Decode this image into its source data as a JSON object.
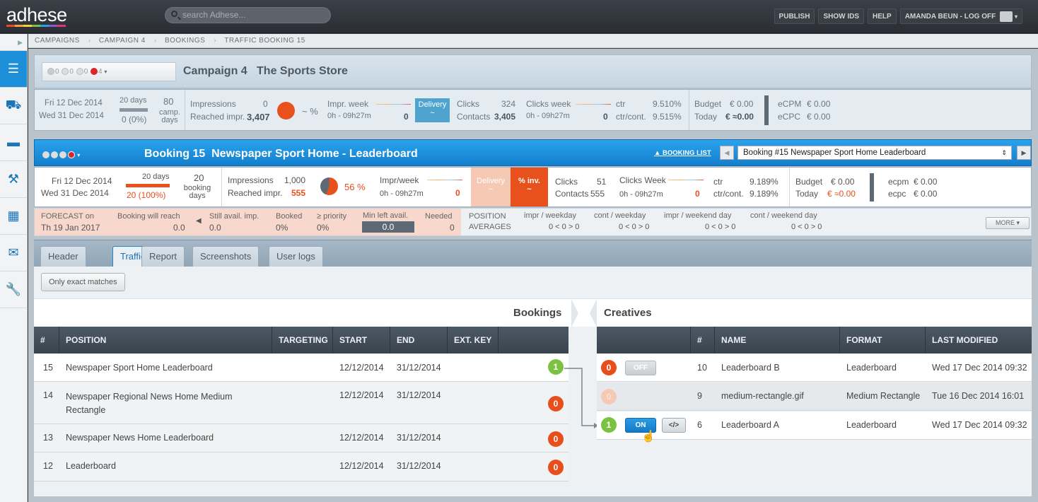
{
  "app": {
    "logo": "adhese",
    "search_placeholder": "search Adhese..."
  },
  "topnav": {
    "publish": "PUBLISH",
    "show_ids": "SHOW IDS",
    "help": "HELP",
    "user": "AMANDA BEUN - LOG OFF"
  },
  "breadcrumb": [
    "CAMPAIGNS",
    "CAMPAIGN 4",
    "BOOKINGS",
    "TRAFFIC BOOKING 15"
  ],
  "campaign": {
    "status_counts": [
      "0",
      "0",
      "0",
      "4"
    ],
    "title": "Campaign 4",
    "advertiser": "The Sports Store",
    "start": "Fri 12 Dec 2014",
    "end": "Wed 31 Dec 2014",
    "days": "20 days",
    "days_progress": "0 (0%)",
    "camp_days_value": "80",
    "camp_days_label": "camp. days",
    "impressions_label": "Impressions",
    "impressions": "0",
    "reached_label": "Reached impr.",
    "reached": "3,407",
    "pct": "~ %",
    "impr_week_label": "Impr. week",
    "impr_week_range": "0h - 09h27m",
    "impr_week_value": "0",
    "delivery_label": "Delivery",
    "delivery_value": "~",
    "clicks_label": "Clicks",
    "clicks": "324",
    "contacts_label": "Contacts",
    "contacts": "3,405",
    "clicks_week_label": "Clicks week",
    "clicks_week_range": "0h - 09h27m",
    "clicks_week_value": "0",
    "ctr_label": "ctr",
    "ctr": "9.510%",
    "ctr_cont_label": "ctr/cont.",
    "ctr_cont": "9.515%",
    "budget_label": "Budget",
    "budget": "€ 0.00",
    "today_label": "Today",
    "today": "€ ≈0.00",
    "ecpm_label": "eCPM",
    "ecpm": "€ 0.00",
    "ecpc_label": "eCPC",
    "ecpc": "€ 0.00"
  },
  "booking": {
    "title": "Booking 15",
    "name": "Newspaper Sport Home - Leaderboard",
    "booking_list": "▲ BOOKING LIST",
    "selected_booking": "Booking #15 Newspaper Sport Home Leaderboard",
    "start": "Fri 12 Dec 2014",
    "end": "Wed 31 Dec 2014",
    "days": "20 days",
    "days_progress": "20 (100%)",
    "booking_days_value": "20",
    "booking_days_label": "booking days",
    "impressions_label": "Impressions",
    "impressions": "1,000",
    "reached_label": "Reached impr.",
    "reached": "555",
    "pct": "56 %",
    "pct_fraction": 0.56,
    "impr_week_label": "Impr/week",
    "impr_week_range": "0h - 09h27m",
    "impr_week_value": "0",
    "delivery_label": "Delivery",
    "delivery_value": "~",
    "inv_label": "% inv.",
    "inv_value": "~",
    "clicks_label": "Clicks",
    "clicks": "51",
    "contacts_label": "Contacts",
    "contacts": "555",
    "clicks_week_label": "Clicks Week",
    "clicks_week_range": "0h - 09h27m",
    "clicks_week_value": "0",
    "ctr_label": "ctr",
    "ctr": "9.189%",
    "ctr_cont_label": "ctr/cont.",
    "ctr_cont": "9.189%",
    "budget_label": "Budget",
    "budget": "€ 0.00",
    "today_label": "Today",
    "today": "€ ≈0.00",
    "ecpm_label": "ecpm",
    "ecpm": "€ 0.00",
    "ecpc_label": "ecpc",
    "ecpc": "€ 0.00"
  },
  "forecast": {
    "label": "FORECAST on",
    "date": "Th 19 Jan 2017",
    "will_reach_label": "Booking will reach",
    "will_reach": "0.0",
    "still_avail_label": "Still avail. imp.",
    "still_avail": "0.0",
    "booked_label": "Booked",
    "booked": "0%",
    "priority_label": "≥ priority",
    "priority": "0%",
    "min_left_label": "Min left avail.",
    "min_left": "0.0",
    "needed_label": "Needed",
    "needed": "0",
    "position_label": "POSITION",
    "averages_label": "AVERAGES",
    "impr_weekday_label": "impr / weekday",
    "impr_weekday": "0 < 0 > 0",
    "cont_weekday_label": "cont / weekday",
    "cont_weekday": "0 < 0 > 0",
    "impr_weekend_label": "impr / weekend day",
    "impr_weekend": "0 < 0 > 0",
    "cont_weekend_label": "cont / weekend day",
    "cont_weekend": "0 < 0 > 0",
    "more": "MORE ▾"
  },
  "tabs": [
    "Header",
    "Traffic",
    "Report",
    "Screenshots",
    "User logs"
  ],
  "filter_button": "Only exact matches",
  "section_bookings": "Bookings",
  "section_creatives": "Creatives",
  "bookings_table": {
    "headers": [
      "#",
      "POSITION",
      "TARGETING",
      "START",
      "END",
      "EXT. KEY"
    ],
    "rows": [
      {
        "id": "15",
        "position": "Newspaper Sport Home Leaderboard",
        "start": "12/12/2014",
        "end": "31/12/2014",
        "count": "1"
      },
      {
        "id": "14",
        "position": "Newspaper Regional News Home Medium Rectangle",
        "start": "12/12/2014",
        "end": "31/12/2014",
        "count": "0"
      },
      {
        "id": "13",
        "position": "Newspaper News Home Leaderboard",
        "start": "12/12/2014",
        "end": "31/12/2014",
        "count": "0"
      },
      {
        "id": "12",
        "position": "Leaderboard",
        "start": "12/12/2014",
        "end": "31/12/2014",
        "count": "0"
      }
    ]
  },
  "creatives_table": {
    "headers": [
      "",
      "#",
      "NAME",
      "FORMAT",
      "LAST MODIFIED"
    ],
    "rows": [
      {
        "count": "0",
        "toggle": "OFF",
        "id": "10",
        "name": "Leaderboard B",
        "format": "Leaderboard",
        "modified": "Wed 17 Dec 2014 09:32"
      },
      {
        "count": "0",
        "toggle": "",
        "id": "9",
        "name": "medium-rectangle.gif",
        "format": "Medium Rectangle",
        "modified": "Tue 16 Dec 2014 16:01"
      },
      {
        "count": "1",
        "toggle": "ON",
        "code": "</>",
        "id": "6",
        "name": "Leaderboard A",
        "format": "Leaderboard",
        "modified": "Wed 17 Dec 2014 09:32"
      }
    ]
  }
}
